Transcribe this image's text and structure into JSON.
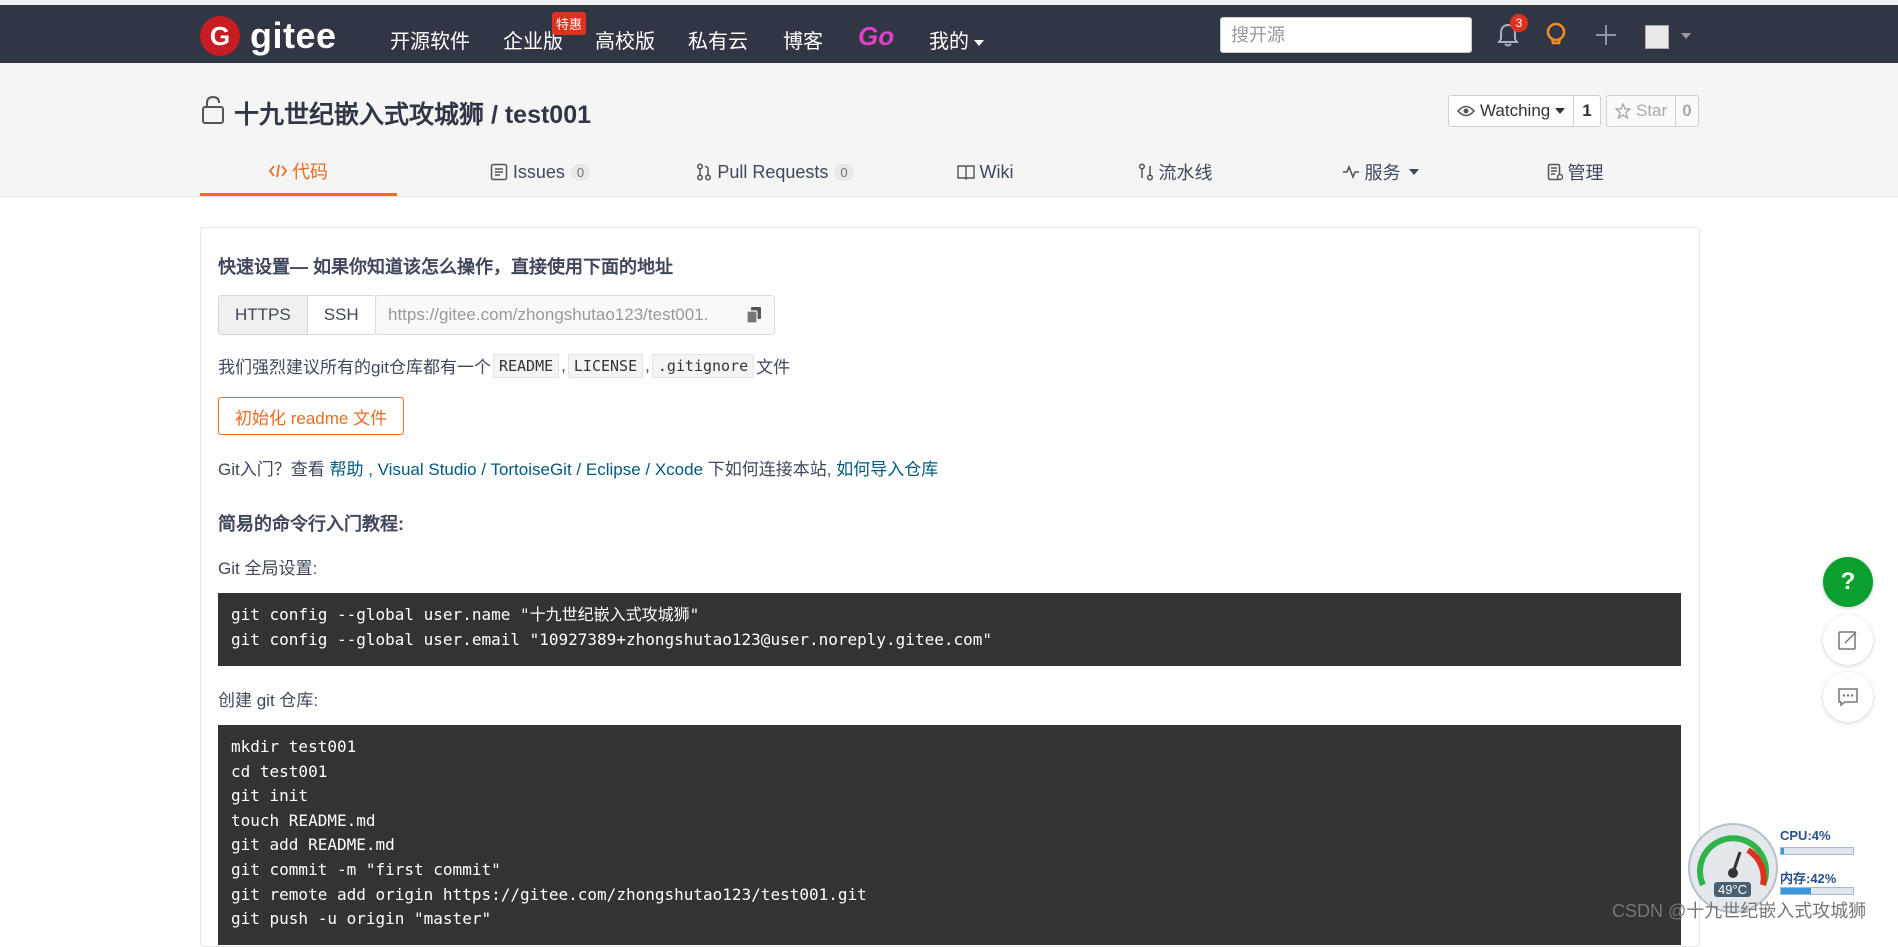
{
  "navbar": {
    "brand": "gitee",
    "links": [
      "开源软件",
      "企业版",
      "高校版",
      "私有云",
      "博客"
    ],
    "special_badge": "特惠",
    "go_label": "Go",
    "mine_label": "我的",
    "search_placeholder": "搜开源",
    "notification_count": "3"
  },
  "repo": {
    "title": "十九世纪嵌入式攻城狮 / test001",
    "watch_label": "Watching",
    "watch_count": "1",
    "star_label": "Star",
    "star_count": "0"
  },
  "tabs": {
    "code": "代码",
    "issues": "Issues",
    "issues_count": "0",
    "pulls": "Pull Requests",
    "pulls_count": "0",
    "wiki": "Wiki",
    "pipeline": "流水线",
    "services": "服务",
    "manage": "管理"
  },
  "quick": {
    "heading": "快速设置— 如果你知道该怎么操作，直接使用下面的地址",
    "https": "HTTPS",
    "ssh": "SSH",
    "url": "https://gitee.com/zhongshutao123/test001.",
    "recommend_prefix": "我们强烈建议所有的git仓库都有一个",
    "readme": "README",
    "license": "LICENSE",
    "gitignore": ".gitignore",
    "recommend_suffix": "文件",
    "sep": ",",
    "init_button": "初始化 readme 文件"
  },
  "intro": {
    "prefix": "Git入门？查看",
    "help": "帮助",
    "vs": "Visual Studio",
    "tortoise": "TortoiseGit",
    "eclipse": "Eclipse",
    "xcode": "Xcode",
    "middle": "下如何连接本站,",
    "import": "如何导入仓库",
    "comma": " , ",
    "slash": " / "
  },
  "cli": {
    "heading": "简易的命令行入门教程:",
    "global_label": "Git 全局设置:",
    "global_code": "git config --global user.name \"十九世纪嵌入式攻城狮\"\ngit config --global user.email \"10927389+zhongshutao123@user.noreply.gitee.com\"",
    "create_label": "创建 git 仓库:",
    "create_code": "mkdir test001\ncd test001\ngit init\ntouch README.md\ngit add README.md\ngit commit -m \"first commit\"\ngit remote add origin https://gitee.com/zhongshutao123/test001.git\ngit push -u origin \"master\""
  },
  "floating": {
    "help": "?"
  },
  "monitor": {
    "cpu": "CPU:4%",
    "cpu_level": 0.04,
    "mem": "内存:42%",
    "mem_level": 0.42,
    "temp": "49°C"
  },
  "watermark": "CSDN @十九世纪嵌入式攻城狮",
  "colors": {
    "nav_bg": "#303643",
    "accent": "#e96c22",
    "brand": "#c71d23",
    "link": "#005980",
    "code_bg": "#333333"
  }
}
